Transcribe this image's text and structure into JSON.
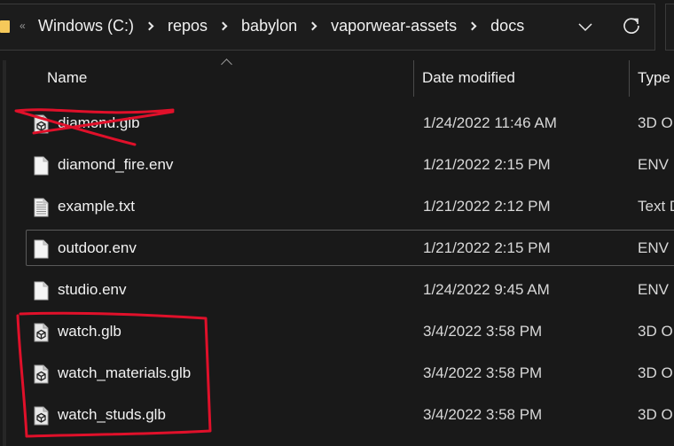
{
  "address_bar": {
    "overflow_label": "«",
    "breadcrumbs": [
      "Windows (C:)",
      "repos",
      "babylon",
      "vaporwear-assets",
      "docs"
    ],
    "icons": {
      "location": "folder-icon",
      "dropdown": "chevron-down-icon",
      "refresh": "refresh-icon"
    }
  },
  "columns": {
    "name": "Name",
    "date_modified": "Date modified",
    "type": "Type",
    "sort_indicator": "chevron-up-icon"
  },
  "files": [
    {
      "name": "diamond.glb",
      "date": "1/24/2022 11:46 AM",
      "type": "3D O",
      "icon": "3d-object-file-icon",
      "annotation": "crossed-out"
    },
    {
      "name": "diamond_fire.env",
      "date": "1/21/2022 2:15 PM",
      "type": "ENV F",
      "icon": "blank-file-icon"
    },
    {
      "name": "example.txt",
      "date": "1/21/2022 2:12 PM",
      "type": "Text D",
      "icon": "text-file-icon"
    },
    {
      "name": "outdoor.env",
      "date": "1/21/2022 2:15 PM",
      "type": "ENV F",
      "icon": "blank-file-icon",
      "focused": true
    },
    {
      "name": "studio.env",
      "date": "1/24/2022 9:45 AM",
      "type": "ENV F",
      "icon": "blank-file-icon"
    },
    {
      "name": "watch.glb",
      "date": "3/4/2022 3:58 PM",
      "type": "3D O",
      "icon": "3d-object-file-icon",
      "annotation": "boxed"
    },
    {
      "name": "watch_materials.glb",
      "date": "3/4/2022 3:58 PM",
      "type": "3D O",
      "icon": "3d-object-file-icon",
      "annotation": "boxed"
    },
    {
      "name": "watch_studs.glb",
      "date": "3/4/2022 3:58 PM",
      "type": "3D O",
      "icon": "3d-object-file-icon",
      "annotation": "boxed"
    }
  ],
  "annotations": {
    "color": "#e0102a",
    "strike_target": "diamond.glb",
    "box_targets": [
      "watch.glb",
      "watch_materials.glb",
      "watch_studs.glb"
    ]
  },
  "colors": {
    "background": "#191919",
    "text": "#f2f2f2",
    "folder": "#f6c95a"
  }
}
